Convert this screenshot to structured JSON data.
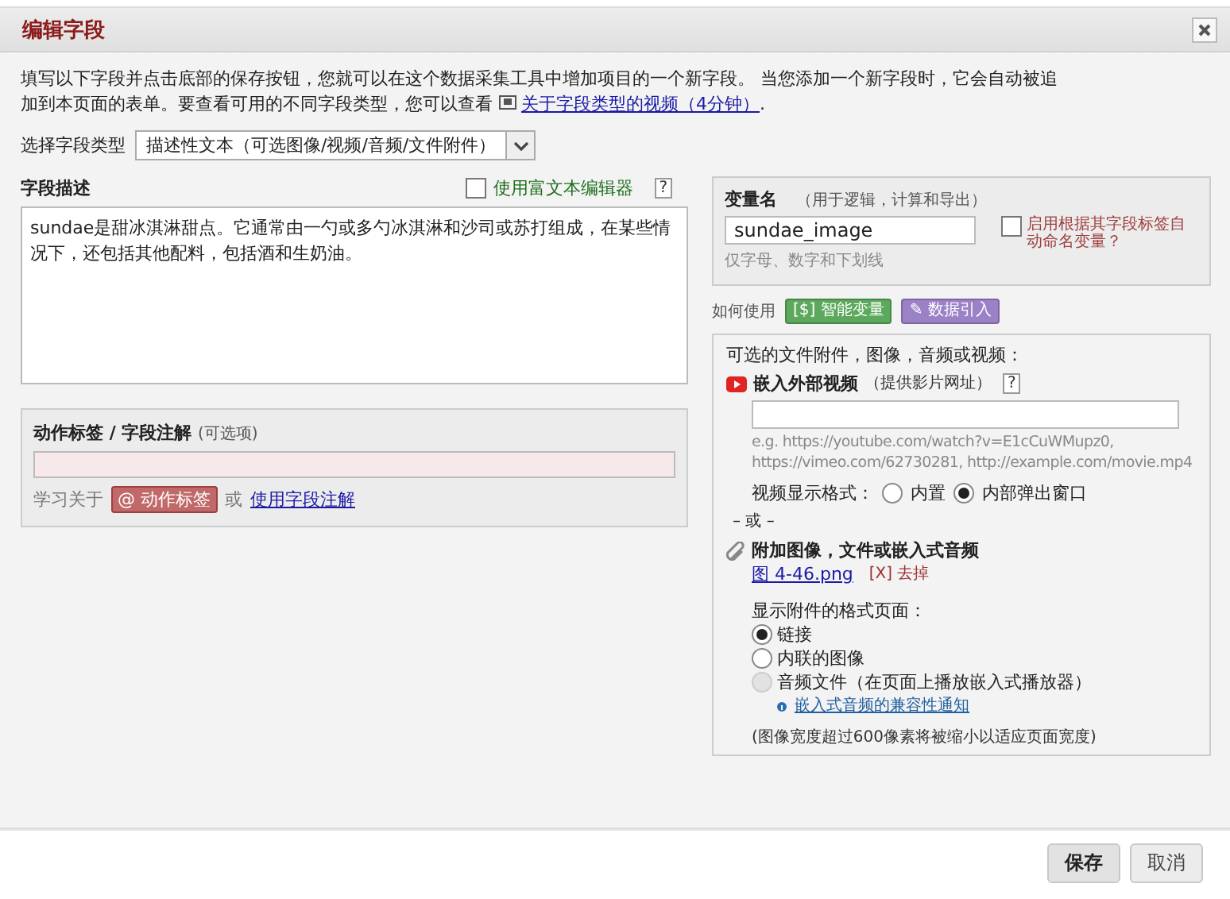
{
  "window": {
    "title": "编辑字段"
  },
  "intro": {
    "text": "填写以下字段并点击底部的保存按钮，您就可以在这个数据采集工具中增加项目的一个新字段。 当您添加一个新字段时，它会自动被追加到本页面的表单。要查看可用的不同字段类型，您可以查看",
    "link": "关于字段类型的视频（4分钟）",
    "after": "."
  },
  "field_type": {
    "label": "选择字段类型",
    "value": "描述性文本（可选图像/视频/音频/文件附件）"
  },
  "description": {
    "label": "字段描述",
    "rich_text": {
      "label": "使用富文本编辑器",
      "checked": false
    },
    "help": "?",
    "value": "sundae是甜冰淇淋甜点。它通常由一勺或多勺冰淇淋和沙司或苏打组成，在某些情况下，还包括其他配料，包括酒和生奶油。"
  },
  "action_tags": {
    "label": "动作标签 / 字段注解",
    "optional": "(可选项)",
    "learn": "学习关于",
    "tag_button": "@ 动作标签",
    "or": "或",
    "link": "使用字段注解"
  },
  "variable": {
    "label": "变量名",
    "hint": "（用于逻辑，计算和导出）",
    "value": "sundae_image",
    "note": "仅字母、数字和下划线",
    "auto_name": {
      "label": "启用根据其字段标签自动命名变量？",
      "checked": false
    }
  },
  "how_to": {
    "label": "如何使用",
    "buttons": [
      {
        "label": "智能变量",
        "mark": "[$]",
        "color": "#5ca85c"
      },
      {
        "label": "数据引入",
        "mark": "✎",
        "color": "#9b82c6"
      }
    ]
  },
  "attachments": {
    "heading": "可选的文件附件，图像，音频或视频：",
    "video": {
      "label": "嵌入外部视频",
      "hint": "（提供影片网址）",
      "help": "?",
      "example": "e.g. https://youtube.com/watch?v=E1cCuWMupz0, https://vimeo.com/62730281, http://example.com/movie.mp4",
      "display_label": "视频显示格式：",
      "options": [
        {
          "label": "内置",
          "selected": false
        },
        {
          "label": "内部弹出窗口",
          "selected": true
        }
      ]
    },
    "or": "– 或 –",
    "attach": {
      "label": "附加图像，文件或嵌入式音频",
      "file": "图 4-46.png",
      "remove_mark": "[X]",
      "remove": "去掉",
      "display_label": "显示附件的格式页面：",
      "options": [
        {
          "label": "链接",
          "selected": true,
          "disabled": false
        },
        {
          "label": "内联的图像",
          "selected": false,
          "disabled": false
        },
        {
          "label": "音频文件（在页面上播放嵌入式播放器）",
          "selected": false,
          "disabled": true
        }
      ],
      "notice": "嵌入式音频的兼容性通知",
      "note": "(图像宽度超过600像素将被缩小以适应页面宽度)"
    }
  },
  "buttons": [
    {
      "label": "保存",
      "kind": "primary"
    },
    {
      "label": "取消",
      "kind": "secondary"
    }
  ]
}
